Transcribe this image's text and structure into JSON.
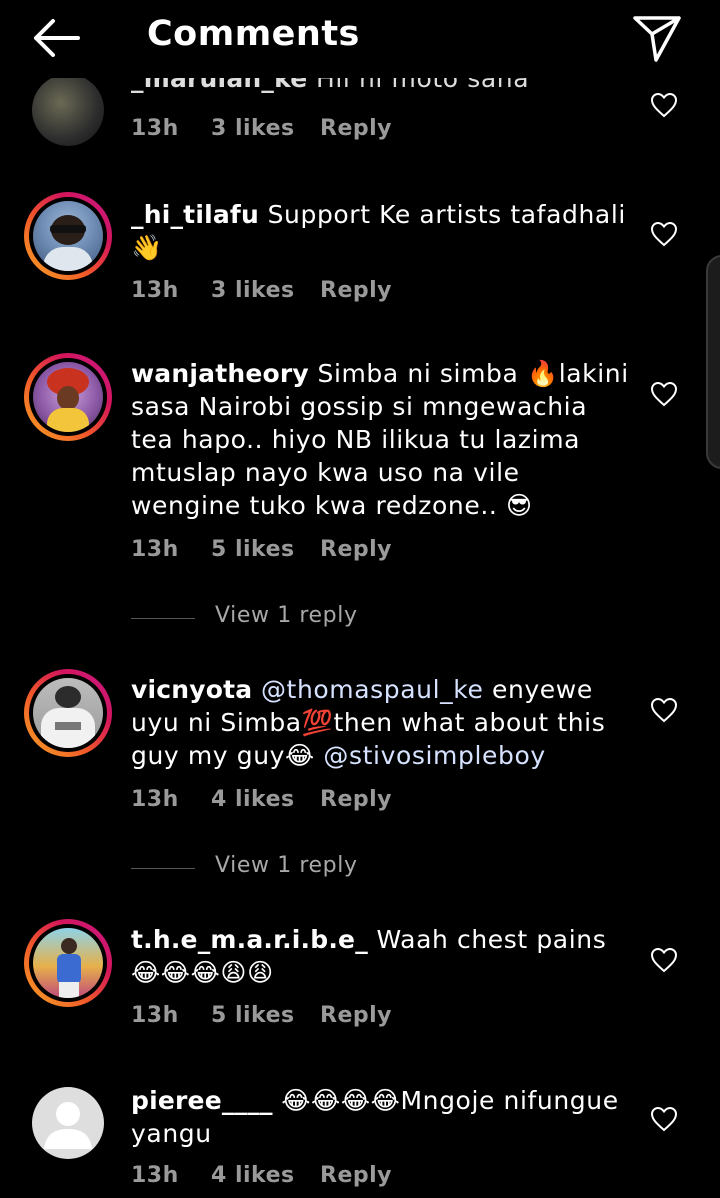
{
  "header": {
    "title": "Comments",
    "back_icon": "arrow-left-icon",
    "send_icon": "paper-plane-icon"
  },
  "comments": [
    {
      "username": "_marulan_ke",
      "text": "Hii ni moto sana",
      "time": "13h",
      "likes": "3 likes",
      "reply": "Reply"
    },
    {
      "username": "_hi_tilafu",
      "text": "Support Ke artists tafadhali 👋",
      "time": "13h",
      "likes": "3 likes",
      "reply": "Reply"
    },
    {
      "username": "wanjatheory",
      "text": "Simba ni simba 🔥lakini sasa Nairobi gossip si mngewachia tea hapo.. hiyo NB ilikua tu lazima mtuslap nayo kwa uso na vile wengine tuko kwa redzone.. 😎",
      "time": "13h",
      "likes": "5 likes",
      "reply": "Reply",
      "view_replies": "View 1 reply"
    },
    {
      "username": "vicnyota",
      "mention1": "@thomaspaul_ke",
      "text_mid": " enyewe uyu ni Simba💯then what about this guy my guy😂 ",
      "mention2": "@stivosimpleboy",
      "time": "13h",
      "likes": "4 likes",
      "reply": "Reply",
      "view_replies": "View 1 reply"
    },
    {
      "username": "t.h.e_m.a.r.i.b.e_",
      "text": "Waah chest pains😂😂😂😩😩",
      "time": "13h",
      "likes": "5 likes",
      "reply": "Reply"
    },
    {
      "username": "pieree____",
      "text": "😂😂😂😂Mngoje nifungue yangu",
      "time": "13h",
      "likes": "4 likes",
      "reply": "Reply"
    }
  ],
  "colors": {
    "background": "#000000",
    "meta": "#9a9a9a",
    "story_ring_start": "#f9a825",
    "story_ring_end": "#c51a8a"
  }
}
